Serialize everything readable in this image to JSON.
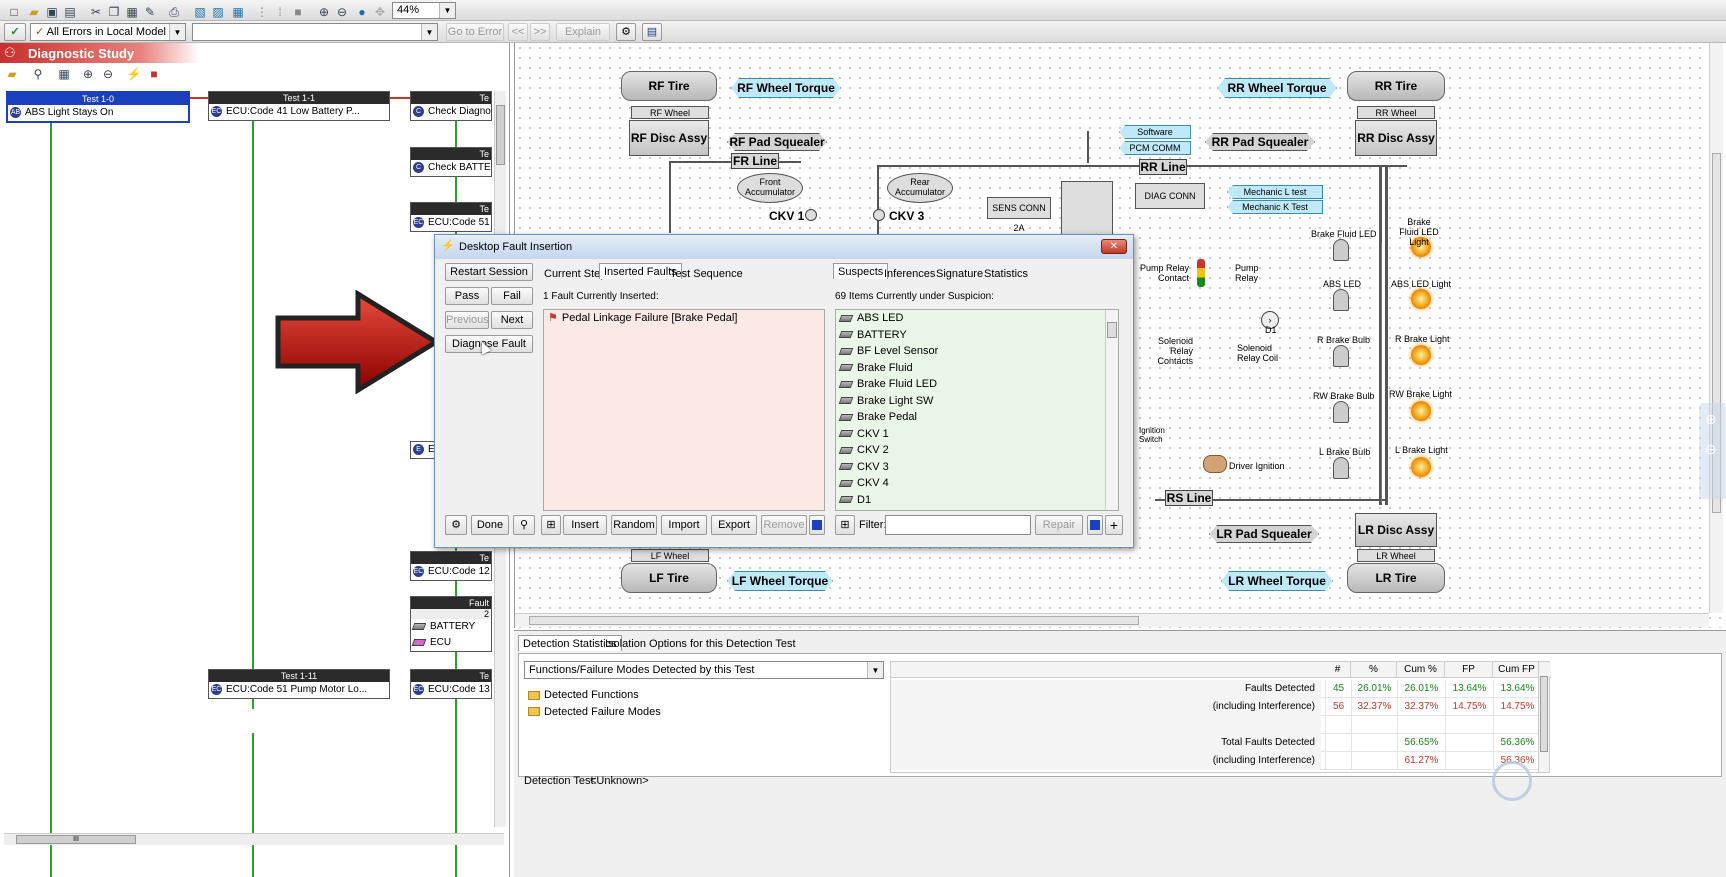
{
  "toolbar": {
    "zoom": "44%",
    "filter_value": "All Errors in Local Model",
    "goto_error": "Go to Error",
    "back": "<<",
    "forward": ">>",
    "explain": "Explain"
  },
  "left_panel": {
    "title": "Diagnostic Study"
  },
  "tests": [
    {
      "header": "Test 1-0",
      "label": "ABS Light Stays On"
    },
    {
      "header": "Test 1-1",
      "label": "ECU:Code 41 Low Battery P..."
    },
    {
      "header": "Te",
      "label": "Check Diagnosi"
    },
    {
      "header": "Te",
      "label": "Check BATTER"
    },
    {
      "header": "Te",
      "label": "ECU:Code 51 P"
    },
    {
      "header": "Te",
      "label": "ECU:Code 12 S"
    },
    {
      "header": "Test 1-11",
      "label": "ECU:Code 51 Pump Motor Lo..."
    },
    {
      "header": "Te",
      "label": "ECU:Code 13 O"
    }
  ],
  "partial_test": "E",
  "fault_node": {
    "header": "Fault",
    "sub": "2",
    "items": [
      "BATTERY",
      "ECU"
    ]
  },
  "scroll_mark": "III",
  "diagram": {
    "tires": {
      "rf": "RF Tire",
      "rr": "RR Tire",
      "lf": "LF Tire",
      "lr": "LR Tire"
    },
    "wheels": {
      "rf": "RF Wheel",
      "rr": "RR Wheel",
      "lf": "LF Wheel",
      "lr": "LR Wheel"
    },
    "torques": {
      "rf": "RF Wheel Torque",
      "rr": "RR Wheel Torque",
      "lf": "LF Wheel Torque",
      "lr": "LR Wheel Torque"
    },
    "disc": {
      "rf": "RF Disc Assy",
      "rr": "RR Disc Assy",
      "lr": "LR Disc Assy"
    },
    "squealers": {
      "rf": "RF Pad Squealer",
      "rr": "RR Pad Squealer",
      "lr": "LR Pad Squealer"
    },
    "lines": {
      "fr": "FR Line",
      "rr": "RR Line",
      "rs": "RS Line"
    },
    "accumulators": {
      "front": "Front Accumulator",
      "rear": "Rear Accumulator"
    },
    "ckv": {
      "one": "CKV 1",
      "three": "CKV 3"
    },
    "sens_conn": "SENS CONN 2A",
    "diag_conn": "DIAG CONN",
    "software": "Software",
    "pcm_comm": "PCM COMM",
    "mech_l": "Mechanic L test",
    "mech_k": "Mechanic K Test",
    "pump_relay_contact": "Pump Relay Contact",
    "pump_relay": "Pump Relay",
    "solenoid_contacts": "Solenoid Relay Contacts",
    "solenoid_coil": "Solenoid Relay Coil",
    "d1": "D1",
    "ignition_switch": "Ignition Switch",
    "driver_ignition": "Driver Ignition",
    "bulbs": [
      "Brake Fluid LED",
      "ABS LED",
      "R Brake Bulb",
      "RW Brake Bulb",
      "L Brake Bulb"
    ],
    "lights": [
      "Brake Fluid LED Light",
      "ABS LED Light",
      "R Brake Light",
      "RW Brake Light",
      "L Brake Light"
    ]
  },
  "dialog": {
    "title": "Desktop Fault Insertion",
    "buttons": {
      "restart": "Restart Session",
      "pass": "Pass",
      "fail": "Fail",
      "previous": "Previous",
      "next": "Next",
      "diagnose": "Diagnose Fault",
      "done": "Done",
      "insert": "Insert",
      "random": "Random",
      "import": "Import",
      "export": "Export",
      "remove": "Remove",
      "repair": "Repair"
    },
    "left_tabs": [
      "Current Step",
      "Inserted Faults",
      "Test Sequence"
    ],
    "inserted_status": "1 Fault Currently Inserted:",
    "inserted_faults": [
      "Pedal Linkage Failure [Brake Pedal]"
    ],
    "right_tabs": [
      "Suspects",
      "Inferences",
      "Signature",
      "Statistics"
    ],
    "suspect_status": "69 Items Currently under Suspicion:",
    "suspects": [
      "ABS LED",
      "BATTERY",
      "BF Level Sensor",
      "Brake Fluid",
      "Brake Fluid LED",
      "Brake Light SW",
      "Brake Pedal",
      "CKV 1",
      "CKV 2",
      "CKV 3",
      "CKV 4",
      "D1"
    ],
    "filter_label": "Filter:"
  },
  "bottom": {
    "tabs": [
      "Detection Statistics",
      "Isolation Options for this Detection Test"
    ],
    "dropdown": "Functions/Failure Modes Detected by this Test",
    "tree": [
      "Detected Functions",
      "Detected Failure Modes"
    ],
    "detection_test_label": "Detection Test:",
    "detection_test_value": "<Unknown>",
    "columns": [
      "#",
      "%",
      "Cum %",
      "FP",
      "Cum FP"
    ],
    "rows": [
      {
        "label": "Faults Detected",
        "vals": [
          "45",
          "26.01%",
          "26.01%",
          "13.64%",
          "13.64%"
        ],
        "color": "#1a8a1a"
      },
      {
        "label": "(including Interference)",
        "vals": [
          "56",
          "32.37%",
          "32.37%",
          "14.75%",
          "14.75%"
        ],
        "color": "#c0392b"
      },
      {
        "label": "",
        "vals": [
          "",
          "",
          "",
          "",
          ""
        ],
        "color": "#000"
      },
      {
        "label": "Total Faults Detected",
        "vals": [
          "",
          "",
          "56.65%",
          "",
          "56.36%"
        ],
        "color": "#1a8a1a"
      },
      {
        "label": "(including Interference)",
        "vals": [
          "",
          "",
          "61.27%",
          "",
          "56.36%"
        ],
        "color": "#c0392b"
      }
    ]
  }
}
